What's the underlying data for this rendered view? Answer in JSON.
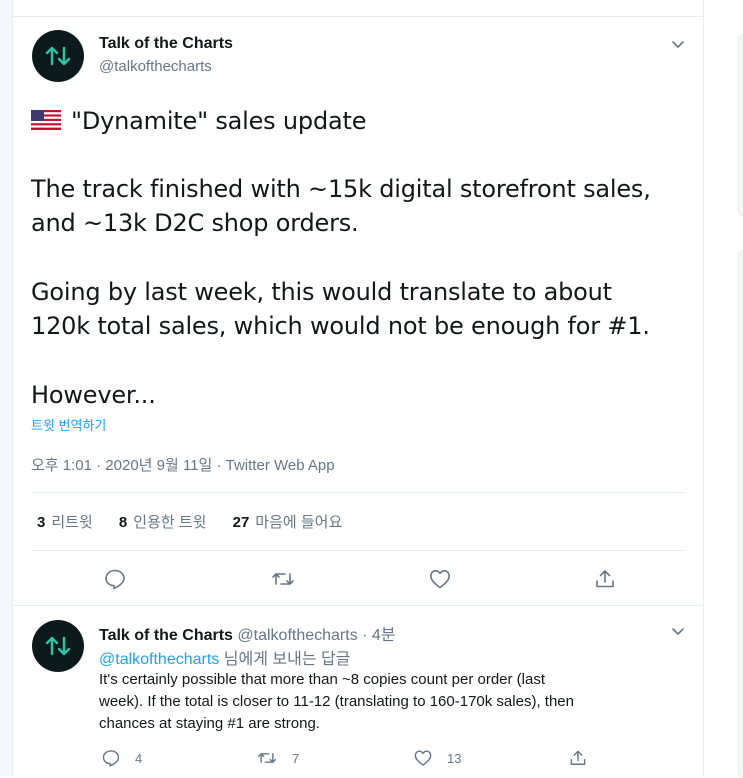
{
  "tweet": {
    "author_name": "Talk of the Charts",
    "author_handle": "@talkofthecharts",
    "line1": "\"Dynamite\" sales update",
    "para2_line1": "The track finished with ~15k digital storefront sales,",
    "para2_line2": "and ~13k D2C shop orders.",
    "para3_line1": "Going by last week, this would translate to about",
    "para3_line2": "120k total sales, which would not be enough for #1.",
    "para4": "However...",
    "translate_link": "트윗 번역하기",
    "timestamp": "오후 1:01 · 2020년 9월 11일 · Twitter Web App",
    "stats": {
      "retweets_count": "3",
      "retweets_label": "리트윗",
      "quotes_count": "8",
      "quotes_label": "인용한 트윗",
      "likes_count": "27",
      "likes_label": "마음에 들어요"
    },
    "icons": [
      "reply-icon",
      "retweet-icon",
      "like-icon",
      "share-icon",
      "chevron-down-icon",
      "us-flag-icon"
    ]
  },
  "reply": {
    "author_name": "Talk of the Charts",
    "author_handle": "@talkofthecharts",
    "time_ago": "· 4분",
    "replying_to_handle": "@talkofthecharts",
    "replying_to_suffix": "님에게 보내는 답글",
    "text_line1": "It's certainly possible that more than ~8 copies count per order (last",
    "text_line2": "week). If the total is closer to 11-12 (translating to 160-170k sales), then",
    "text_line3": "chances at staying #1 are strong.",
    "reply_count": "4",
    "retweet_count": "7",
    "like_count": "13"
  },
  "colors": {
    "accent": "#1da1f2",
    "secondary_text": "#657786",
    "border": "#e6ecf0",
    "avatar_bg": "#0c1a1c",
    "avatar_logo": "#2ec4a6"
  }
}
